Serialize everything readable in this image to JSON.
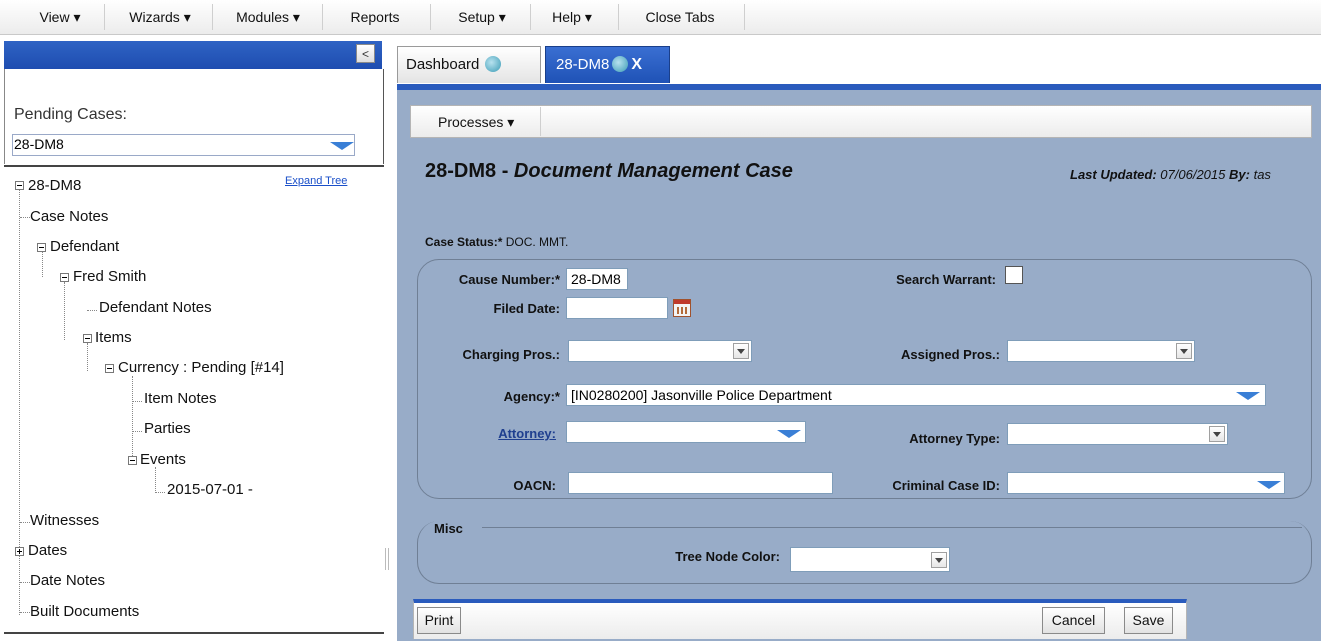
{
  "menu": {
    "items": [
      {
        "label": "View ▾"
      },
      {
        "label": "Wizards ▾"
      },
      {
        "label": "Modules ▾"
      },
      {
        "label": "Reports"
      },
      {
        "label": "Setup ▾"
      },
      {
        "label": "Help ▾"
      },
      {
        "label": "Close Tabs"
      }
    ]
  },
  "sidebar": {
    "collapse_glyph": "<",
    "pending_label": "Pending Cases:",
    "pending_value": "28-DM8",
    "expand_tree": "Expand Tree",
    "tree": [
      {
        "label": "28-DM8",
        "toggle": "minus"
      },
      {
        "label": "Case Notes"
      },
      {
        "label": "Defendant",
        "toggle": "minus"
      },
      {
        "label": "Fred Smith",
        "toggle": "minus"
      },
      {
        "label": "Defendant Notes"
      },
      {
        "label": "Items",
        "toggle": "minus"
      },
      {
        "label": "Currency : Pending [#14]",
        "toggle": "minus"
      },
      {
        "label": "Item Notes"
      },
      {
        "label": "Parties"
      },
      {
        "label": "Events",
        "toggle": "minus"
      },
      {
        "label": "2015-07-01 -"
      },
      {
        "label": "Witnesses"
      },
      {
        "label": "Dates",
        "toggle": "plus"
      },
      {
        "label": "Date Notes"
      },
      {
        "label": "Built Documents"
      }
    ]
  },
  "tabs": {
    "dashboard": "Dashboard",
    "case": "28-DM8",
    "close": "X"
  },
  "toolbar": {
    "processes": "Processes ▾"
  },
  "case": {
    "id": "28-DM8",
    "separator": " - ",
    "type": "Document Management Case",
    "last_updated_label": "Last Updated:",
    "last_updated_value": "07/06/2015",
    "by_label": "By:",
    "by_value": "tas",
    "status_label": "Case Status:*",
    "status_value": "DOC. MMT."
  },
  "form": {
    "cause_number_label": "Cause Number:*",
    "cause_number_value": "28-DM8",
    "search_warrant_label": "Search Warrant:",
    "filed_date_label": "Filed Date:",
    "filed_date_value": "",
    "charging_pros_label": "Charging Pros.:",
    "charging_pros_value": "",
    "assigned_pros_label": "Assigned Pros.:",
    "assigned_pros_value": "",
    "agency_label": "Agency:*",
    "agency_value": "[IN0280200] Jasonville Police Department",
    "attorney_label": "Attorney:",
    "attorney_value": "",
    "attorney_type_label": "Attorney Type:",
    "attorney_type_value": "",
    "oacn_label": "OACN:",
    "oacn_value": "",
    "criminal_case_id_label": "Criminal Case ID:",
    "criminal_case_id_value": "",
    "misc_legend": "Misc",
    "tree_node_color_label": "Tree Node Color:",
    "tree_node_color_value": ""
  },
  "footer": {
    "print": "Print",
    "cancel": "Cancel",
    "save": "Save"
  }
}
